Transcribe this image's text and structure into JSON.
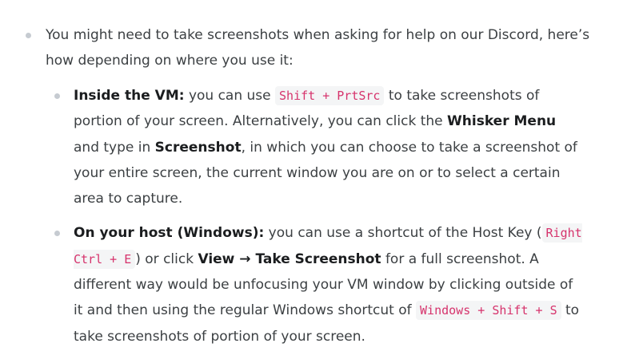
{
  "item1": {
    "text": "You might need to take screenshots when asking for help on our Discord, here’s how depending on where you use it:"
  },
  "vm": {
    "label": "Inside the VM:",
    "t1": " you can use ",
    "code1": "Shift + PrtSrc",
    "t2": " to take screenshots of portion of your screen. Alternatively, you can click the ",
    "b1": "Whisker Menu",
    "t3": " and type in ",
    "b2": "Screenshot",
    "t4": ", in which you can choose to take a screenshot of your entire screen, the current window you are on or to select a certain area to capture."
  },
  "host": {
    "label": "On your host (Windows):",
    "t1": " you can use a shortcut of the Host Key (",
    "code1": "Right Ctrl + E",
    "t2": ") or click ",
    "b1": "View → Take Screenshot",
    "t3": " for a full screenshot. A different way would be unfocusing your VM window by clicking outside of it and then using the regular Windows shortcut of ",
    "code2": "Windows + Shift + S",
    "t4": " to take screenshots of portion of your screen."
  }
}
